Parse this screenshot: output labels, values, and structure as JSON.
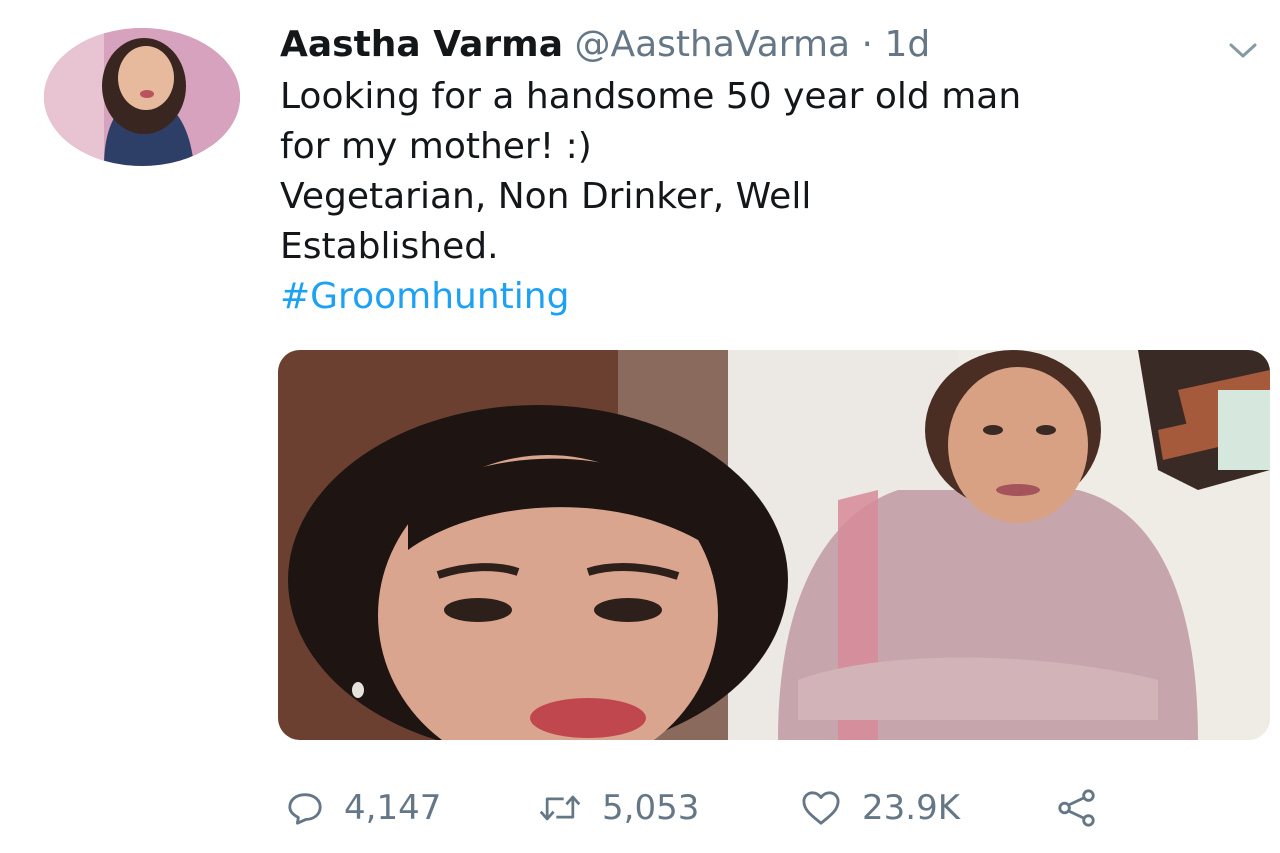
{
  "tweet": {
    "author_name": "Aastha Varma",
    "handle": "@AasthaVarma",
    "separator": "·",
    "time": "1d",
    "text_lines": [
      "Looking for a handsome 50 year old man",
      "for my mother! :)",
      "Vegetarian, Non Drinker, Well",
      "Established."
    ],
    "hashtag": "#Groomhunting"
  },
  "actions": {
    "replies": "4,147",
    "retweets": "5,053",
    "likes": "23.9K"
  },
  "icons": [
    "avatar",
    "chevron-down-icon",
    "reply-icon",
    "retweet-icon",
    "like-icon",
    "share-icon"
  ],
  "colors": {
    "link": "#1da1f2",
    "secondary_text": "#657786",
    "primary_text": "#14171a"
  }
}
